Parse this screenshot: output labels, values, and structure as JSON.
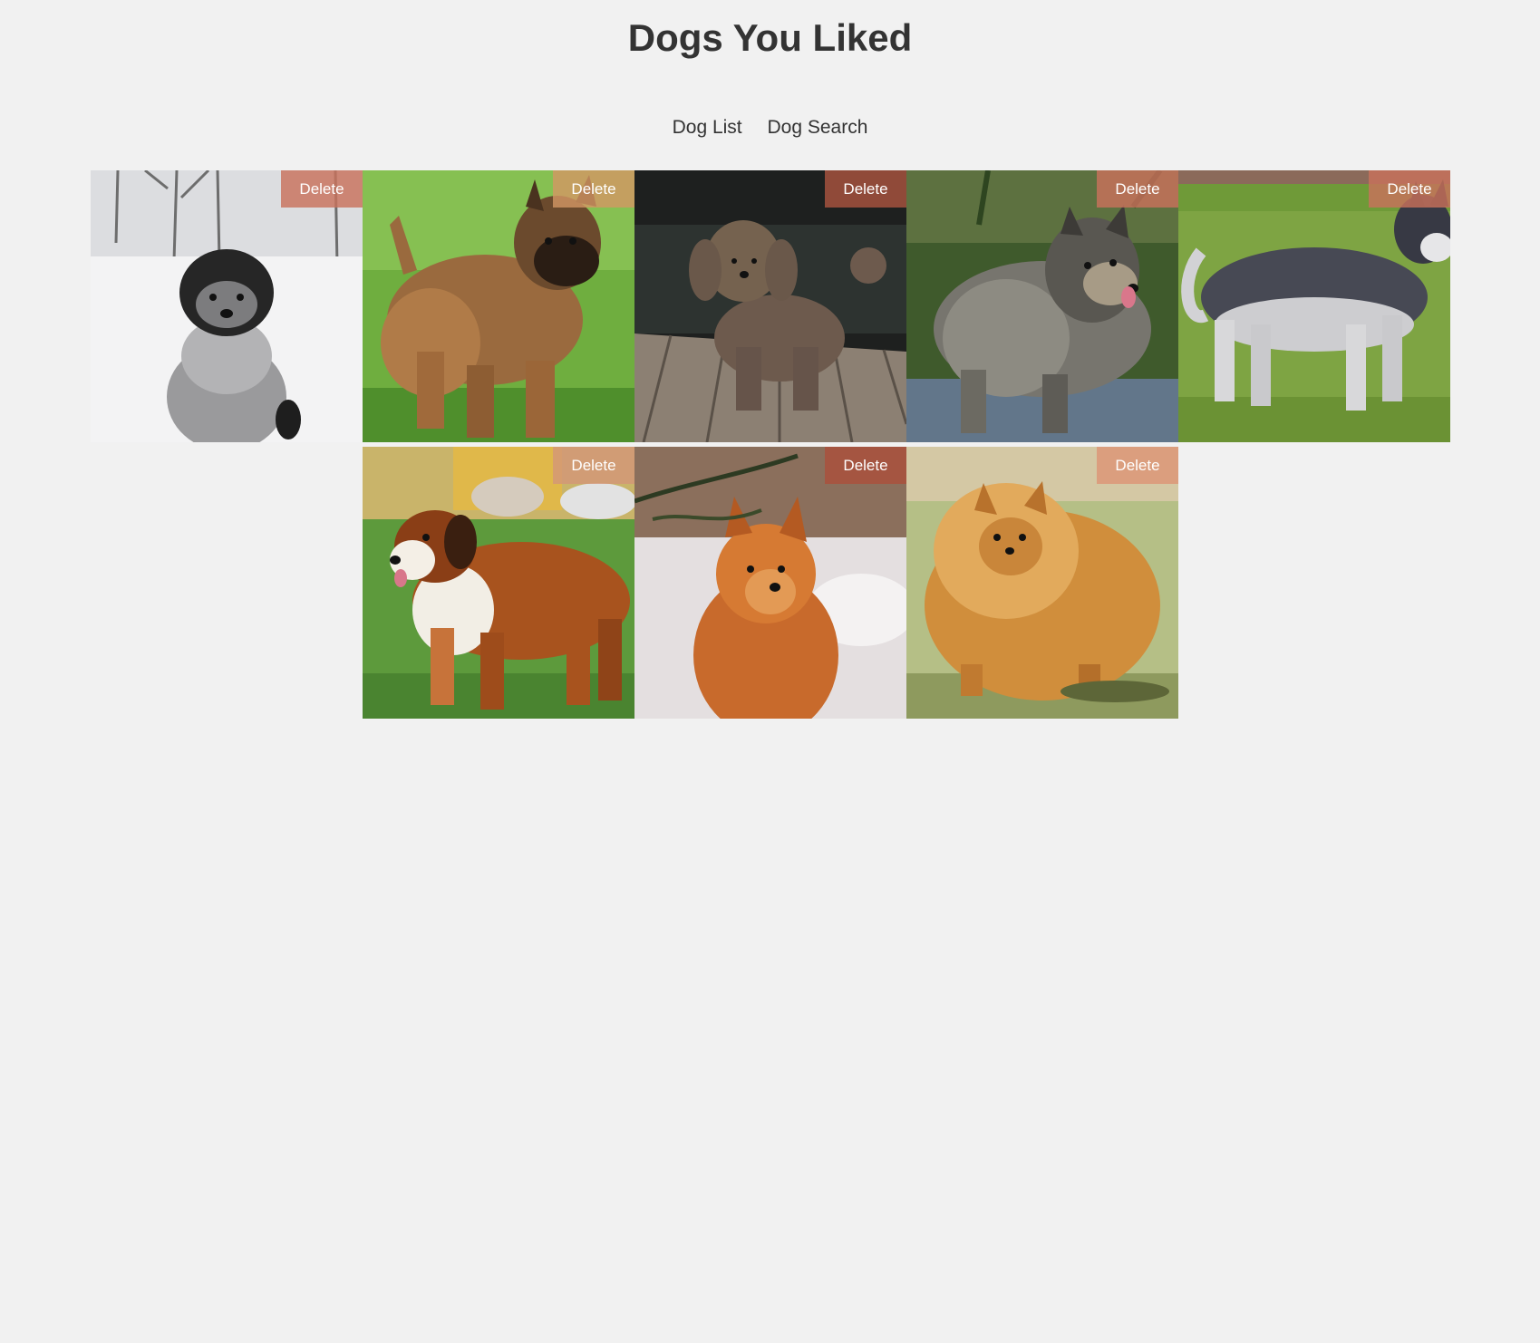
{
  "header": {
    "title": "Dogs You Liked"
  },
  "nav": {
    "items": [
      {
        "label": "Dog List"
      },
      {
        "label": "Dog Search"
      }
    ]
  },
  "colors": {
    "background": "#f1f1f1",
    "text": "#333333",
    "delete_button": "#c8725c"
  },
  "gallery": {
    "dogs": [
      {
        "delete_label": "Delete"
      },
      {
        "delete_label": "Delete"
      },
      {
        "delete_label": "Delete"
      },
      {
        "delete_label": "Delete"
      },
      {
        "delete_label": "Delete"
      },
      {
        "delete_label": "Delete"
      },
      {
        "delete_label": "Delete"
      },
      {
        "delete_label": "Delete"
      }
    ]
  }
}
